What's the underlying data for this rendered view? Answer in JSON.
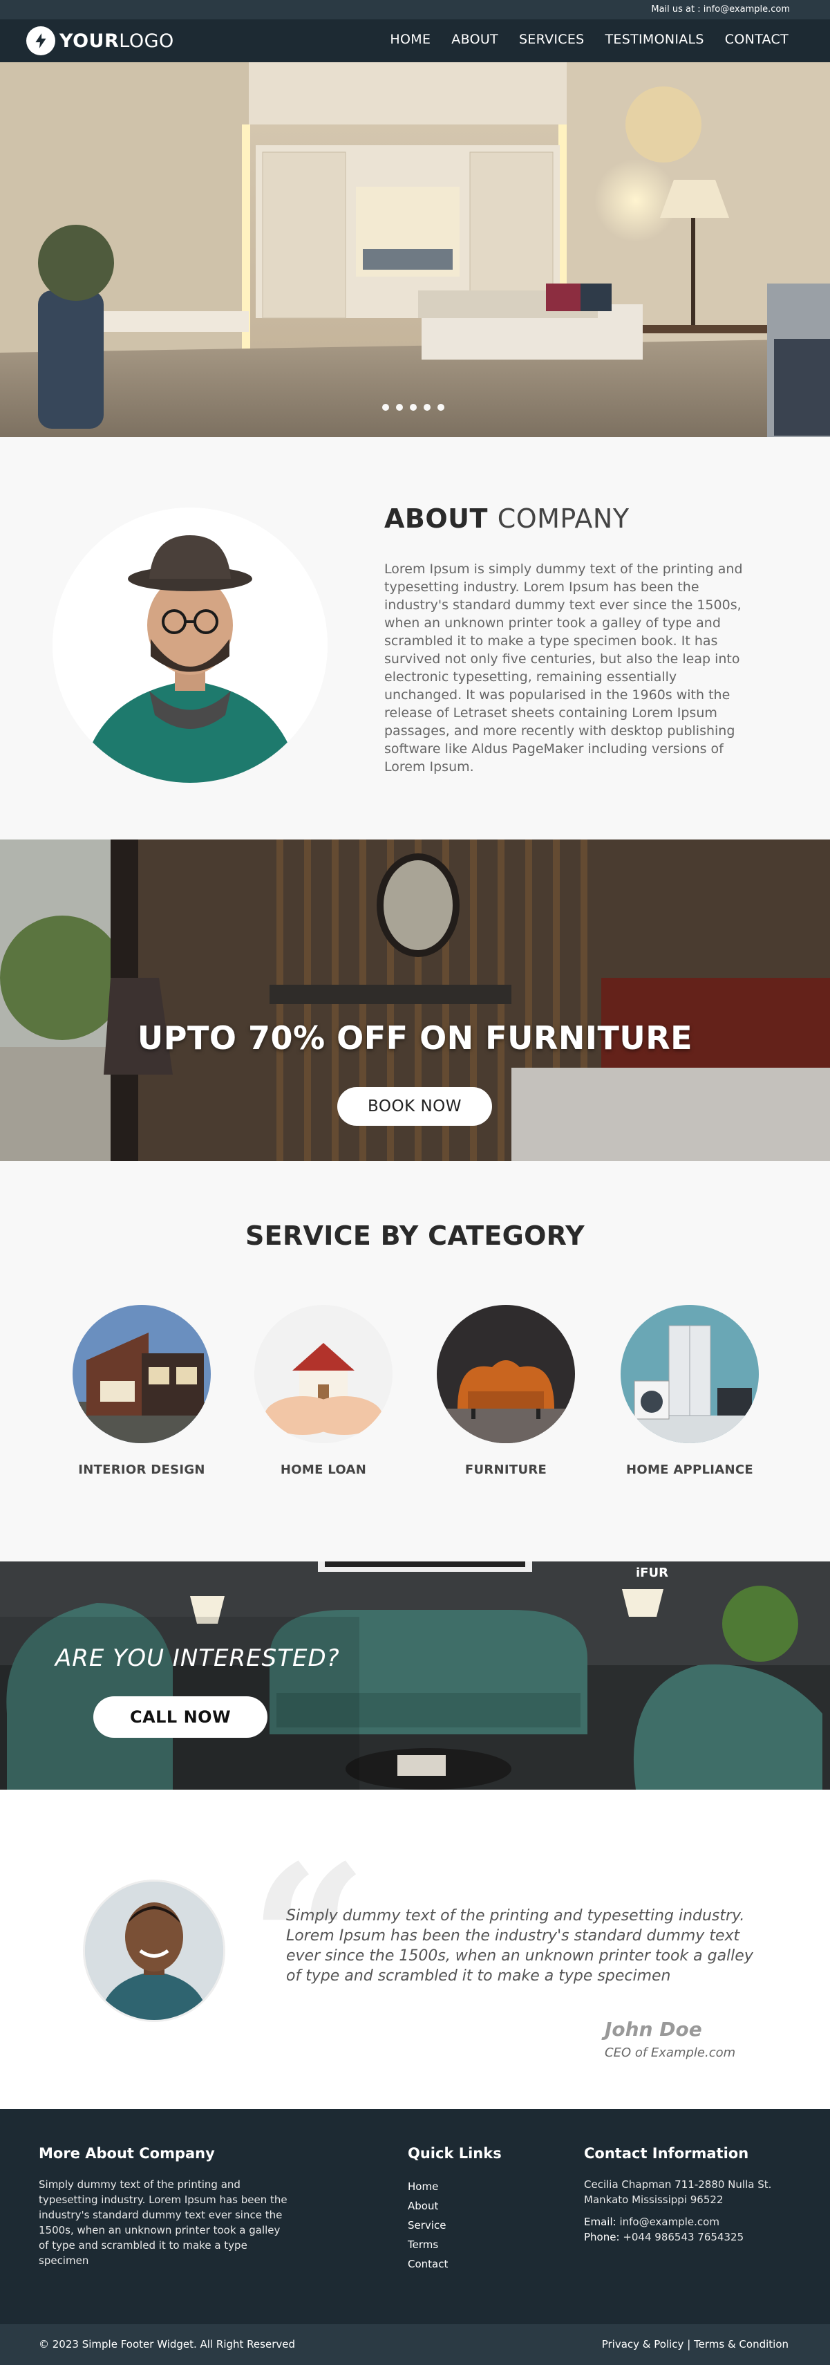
{
  "topbar": {
    "mail": "Mail us at : info@example.com"
  },
  "nav": {
    "logo_bold": "YOUR",
    "logo_light": "LOGO",
    "menu": [
      "HOME",
      "ABOUT",
      "SERVICES",
      "TESTIMONIALS",
      "CONTACT"
    ]
  },
  "hero": {
    "slides": 5
  },
  "about": {
    "title_bold": "ABOUT",
    "title_light": "COMPANY",
    "text": "Lorem Ipsum is simply dummy text of the printing and typesetting industry. Lorem Ipsum has been the industry's standard dummy text ever since the 1500s, when an unknown printer took a galley of type and scrambled it to make a type specimen book. It has survived not only five centuries, but also the leap into electronic typesetting, remaining essentially unchanged. It was popularised in the 1960s with the release of Letraset sheets containing Lorem Ipsum passages, and more recently with desktop publishing software like Aldus PageMaker including versions of Lorem Ipsum."
  },
  "promo": {
    "title": "UPTO 70% OFF ON FURNITURE",
    "button": "BOOK NOW"
  },
  "services": {
    "title": "SERVICE BY CATEGORY",
    "items": [
      {
        "label": "INTERIOR DESIGN",
        "icon": "house-icon"
      },
      {
        "label": "HOME LOAN",
        "icon": "home-in-hands-icon"
      },
      {
        "label": "FURNITURE",
        "icon": "sofa-icon"
      },
      {
        "label": "HOME APPLIANCE",
        "icon": "appliance-icon"
      }
    ]
  },
  "interest": {
    "title": "ARE YOU INTERESTED?",
    "button": "CALL NOW",
    "sign": "iFUR"
  },
  "testimonial": {
    "text": "Simply dummy text of the printing and typesetting industry. Lorem Ipsum has been the industry's standard dummy text ever since the 1500s, when an unknown printer took a galley of type and scrambled it to make a type specimen",
    "name": "John Doe",
    "role": "CEO of Example.com"
  },
  "footer": {
    "about_title": "More About Company",
    "about_text": "Simply dummy text of the printing and typesetting industry. Lorem Ipsum has been the industry's standard dummy text ever since the 1500s, when an unknown printer took a galley of type and scrambled it to make a type specimen",
    "links_title": "Quick Links",
    "links": [
      "Home",
      "About",
      "Service",
      "Terms",
      "Contact"
    ],
    "contact_title": "Contact Information",
    "address": "Cecilia Chapman 711-2880 Nulla St. Mankato Mississippi 96522",
    "email_label": "Email:",
    "email": "info@example.com",
    "phone_label": "Phone:",
    "phone": "+044 986543 7654325",
    "copyright": "© 2023 Simple Footer Widget. All Right Reserved",
    "legal": "Privacy & Policy | Terms & Condition"
  },
  "colors": {
    "nav_bg": "#1d2a33",
    "topbar_bg": "#2b3a44",
    "section_bg": "#f8f8f8"
  }
}
